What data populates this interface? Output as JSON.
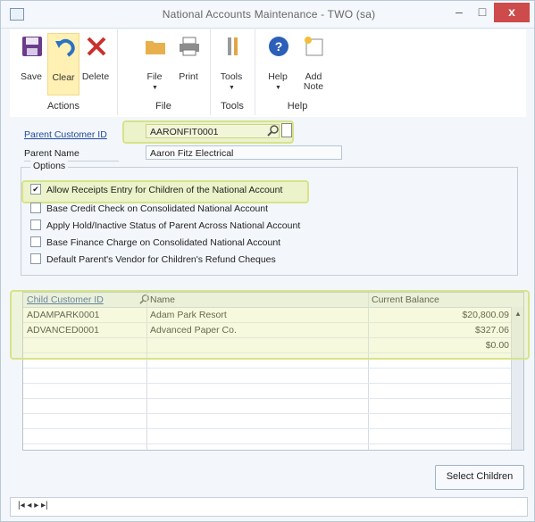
{
  "window": {
    "title": "National Accounts Maintenance  -  TWO (sa)",
    "controls": {
      "minimize": "–",
      "maximize": "□",
      "close": "x"
    }
  },
  "ribbon": {
    "groups": [
      {
        "label": "Actions",
        "buttons": [
          "Save",
          "Clear",
          "Delete"
        ]
      },
      {
        "label": "File",
        "buttons": [
          "File",
          "Print"
        ]
      },
      {
        "label": "Tools",
        "buttons": [
          "Tools"
        ]
      },
      {
        "label": "Help",
        "buttons": [
          "Help",
          "Add Note"
        ]
      }
    ]
  },
  "form": {
    "parent_customer_id_label": "Parent Customer ID",
    "parent_customer_id_value": "AARONFIT0001",
    "parent_name_label": "Parent Name",
    "parent_name_value": "Aaron Fitz Electrical",
    "options_title": "Options",
    "options": [
      {
        "label": "Allow Receipts Entry for Children of the National Account",
        "checked": true
      },
      {
        "label": "Base Credit Check on Consolidated National Account",
        "checked": false
      },
      {
        "label": "Apply Hold/Inactive Status of Parent Across National Account",
        "checked": false
      },
      {
        "label": "Base Finance Charge on Consolidated National Account",
        "checked": false
      },
      {
        "label": "Default Parent's Vendor for Children's Refund Cheques",
        "checked": false
      }
    ]
  },
  "grid": {
    "headers": {
      "child_id": "Child Customer ID",
      "name": "Name",
      "balance": "Current Balance"
    },
    "rows": [
      {
        "child_id": "ADAMPARK0001",
        "name": "Adam Park Resort",
        "balance": "$20,800.09"
      },
      {
        "child_id": "ADVANCED0001",
        "name": "Advanced Paper Co.",
        "balance": "$327.06"
      },
      {
        "child_id": "",
        "name": "",
        "balance": "$0.00"
      }
    ]
  },
  "actions": {
    "select_children": "Select Children"
  },
  "statusbar": {
    "nav": "|◂ ◂ ▸ ▸|"
  },
  "colors": {
    "highlight": "#e5efa0",
    "link": "#1f4b9c",
    "close_button": "#cd4b4b"
  }
}
